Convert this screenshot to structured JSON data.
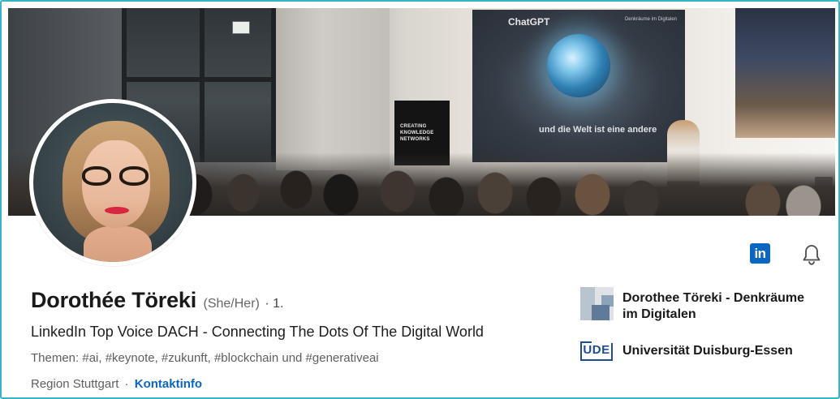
{
  "profile": {
    "name": "Dorothée Töreki",
    "pronouns": "(She/Her)",
    "degree": "· 1.",
    "headline": "LinkedIn Top Voice DACH - Connecting The Dots Of The Digital World",
    "topics": "Themen: #ai, #keynote, #zukunft, #blockchain und #generativeai",
    "location": "Region Stuttgart",
    "separator": "·",
    "contact_link": "Kontaktinfo"
  },
  "banner": {
    "screen_title": "ChatGPT",
    "screen_subtitle": "und die Welt ist eine andere",
    "screen_corner": "Denkräume im Digitalen",
    "standee_text": "CREATING KNOWLEDGE NETWORKS"
  },
  "actions": {
    "linkedin_label": "in",
    "icons": [
      "linkedin-icon",
      "bell-icon"
    ]
  },
  "experience": [
    {
      "name": "Dorothee Töreki - Denkräume im Digitalen",
      "logo": "denkraeume-logo"
    },
    {
      "name": "Universität Duisburg-Essen",
      "logo_text": "UDE"
    }
  ],
  "colors": {
    "frame_border": "#35b3c9",
    "link_blue": "#0a66c2",
    "ude_blue": "#1e4e92"
  }
}
